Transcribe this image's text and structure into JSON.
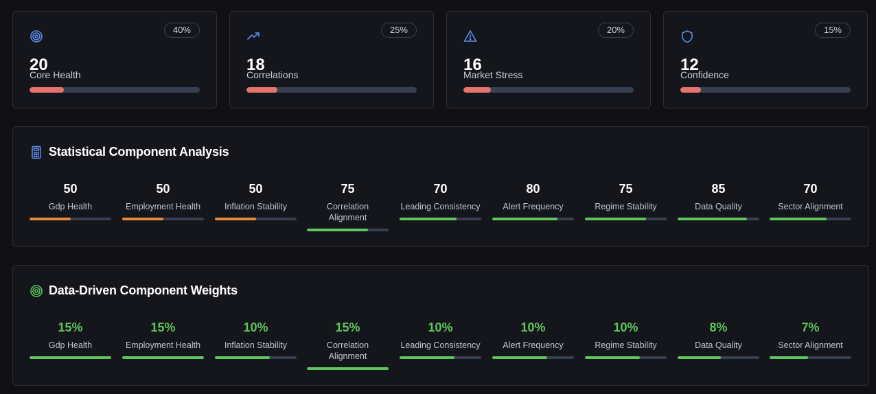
{
  "summary_cards": [
    {
      "icon": "target-icon",
      "percent": "40%",
      "value": "20",
      "label": "Core Health",
      "progress": 0.2,
      "color": "#e5736f"
    },
    {
      "icon": "trending-up-icon",
      "percent": "25%",
      "value": "18",
      "label": "Correlations",
      "progress": 0.18,
      "color": "#e5736f"
    },
    {
      "icon": "alert-triangle-icon",
      "percent": "20%",
      "value": "16",
      "label": "Market Stress",
      "progress": 0.16,
      "color": "#e5736f"
    },
    {
      "icon": "shield-icon",
      "percent": "15%",
      "value": "12",
      "label": "Confidence",
      "progress": 0.12,
      "color": "#e5736f"
    }
  ],
  "analysis": {
    "title": "Statistical Component Analysis",
    "icon": "calculator-icon",
    "metrics": [
      {
        "value": "50",
        "label": "Gdp Health",
        "progress": 0.5,
        "color": "#e58a3f"
      },
      {
        "value": "50",
        "label": "Employment Health",
        "progress": 0.5,
        "color": "#e58a3f"
      },
      {
        "value": "50",
        "label": "Inflation Stability",
        "progress": 0.5,
        "color": "#e58a3f"
      },
      {
        "value": "75",
        "label": "Correlation Alignment",
        "progress": 0.75,
        "color": "#5ec45e"
      },
      {
        "value": "70",
        "label": "Leading Consistency",
        "progress": 0.7,
        "color": "#5ec45e"
      },
      {
        "value": "80",
        "label": "Alert Frequency",
        "progress": 0.8,
        "color": "#5ec45e"
      },
      {
        "value": "75",
        "label": "Regime Stability",
        "progress": 0.75,
        "color": "#5ec45e"
      },
      {
        "value": "85",
        "label": "Data Quality",
        "progress": 0.85,
        "color": "#5ec45e"
      },
      {
        "value": "70",
        "label": "Sector Alignment",
        "progress": 0.7,
        "color": "#5ec45e"
      }
    ]
  },
  "weights": {
    "title": "Data-Driven Component Weights",
    "icon": "target-icon",
    "metrics": [
      {
        "value": "15%",
        "label": "Gdp Health",
        "progress": 1.0,
        "color": "#5ec45e"
      },
      {
        "value": "15%",
        "label": "Employment Health",
        "progress": 1.0,
        "color": "#5ec45e"
      },
      {
        "value": "10%",
        "label": "Inflation Stability",
        "progress": 0.67,
        "color": "#5ec45e"
      },
      {
        "value": "15%",
        "label": "Correlation Alignment",
        "progress": 1.0,
        "color": "#5ec45e"
      },
      {
        "value": "10%",
        "label": "Leading Consistency",
        "progress": 0.67,
        "color": "#5ec45e"
      },
      {
        "value": "10%",
        "label": "Alert Frequency",
        "progress": 0.67,
        "color": "#5ec45e"
      },
      {
        "value": "10%",
        "label": "Regime Stability",
        "progress": 0.67,
        "color": "#5ec45e"
      },
      {
        "value": "8%",
        "label": "Data Quality",
        "progress": 0.53,
        "color": "#5ec45e"
      },
      {
        "value": "7%",
        "label": "Sector Alignment",
        "progress": 0.47,
        "color": "#5ec45e"
      }
    ]
  }
}
